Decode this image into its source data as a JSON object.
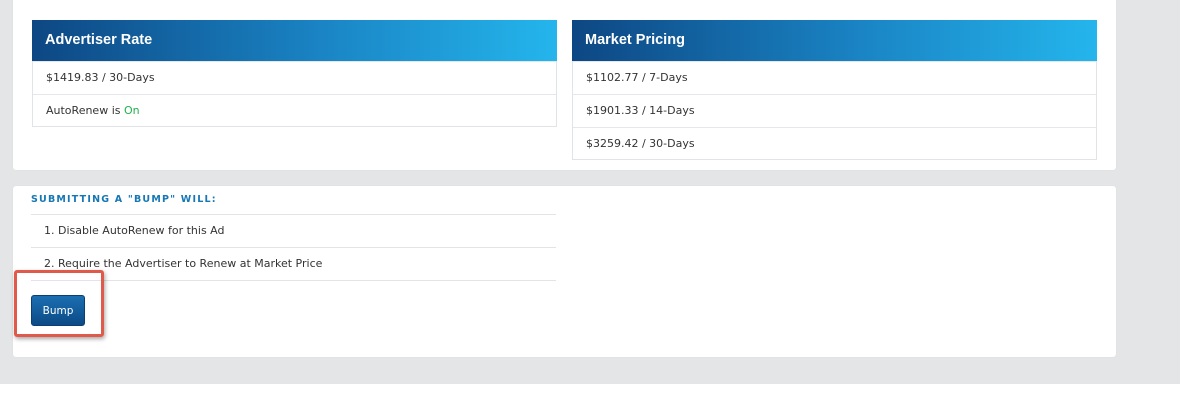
{
  "advertiser_rate": {
    "title": "Advertiser Rate",
    "price_line": "$1419.83 / 30-Days",
    "autorenew_prefix": "AutoRenew is ",
    "autorenew_status": "On"
  },
  "market_pricing": {
    "title": "Market Pricing",
    "rows": [
      "$1102.77 / 7-Days",
      "$1901.33 / 14-Days",
      "$3259.42 / 30-Days"
    ]
  },
  "bump": {
    "title": "SUBMITTING A \"BUMP\" WILL:",
    "items": [
      "1. Disable AutoRenew for this Ad",
      "2. Require the Advertiser to Renew at Market Price"
    ],
    "button_label": "Bump"
  },
  "colors": {
    "header_gradient_start": "#0d4783",
    "header_gradient_end": "#24b5ec",
    "autorenew_on": "#1fb14b",
    "section_title": "#1577b5",
    "highlight_border": "#e05a4b"
  }
}
